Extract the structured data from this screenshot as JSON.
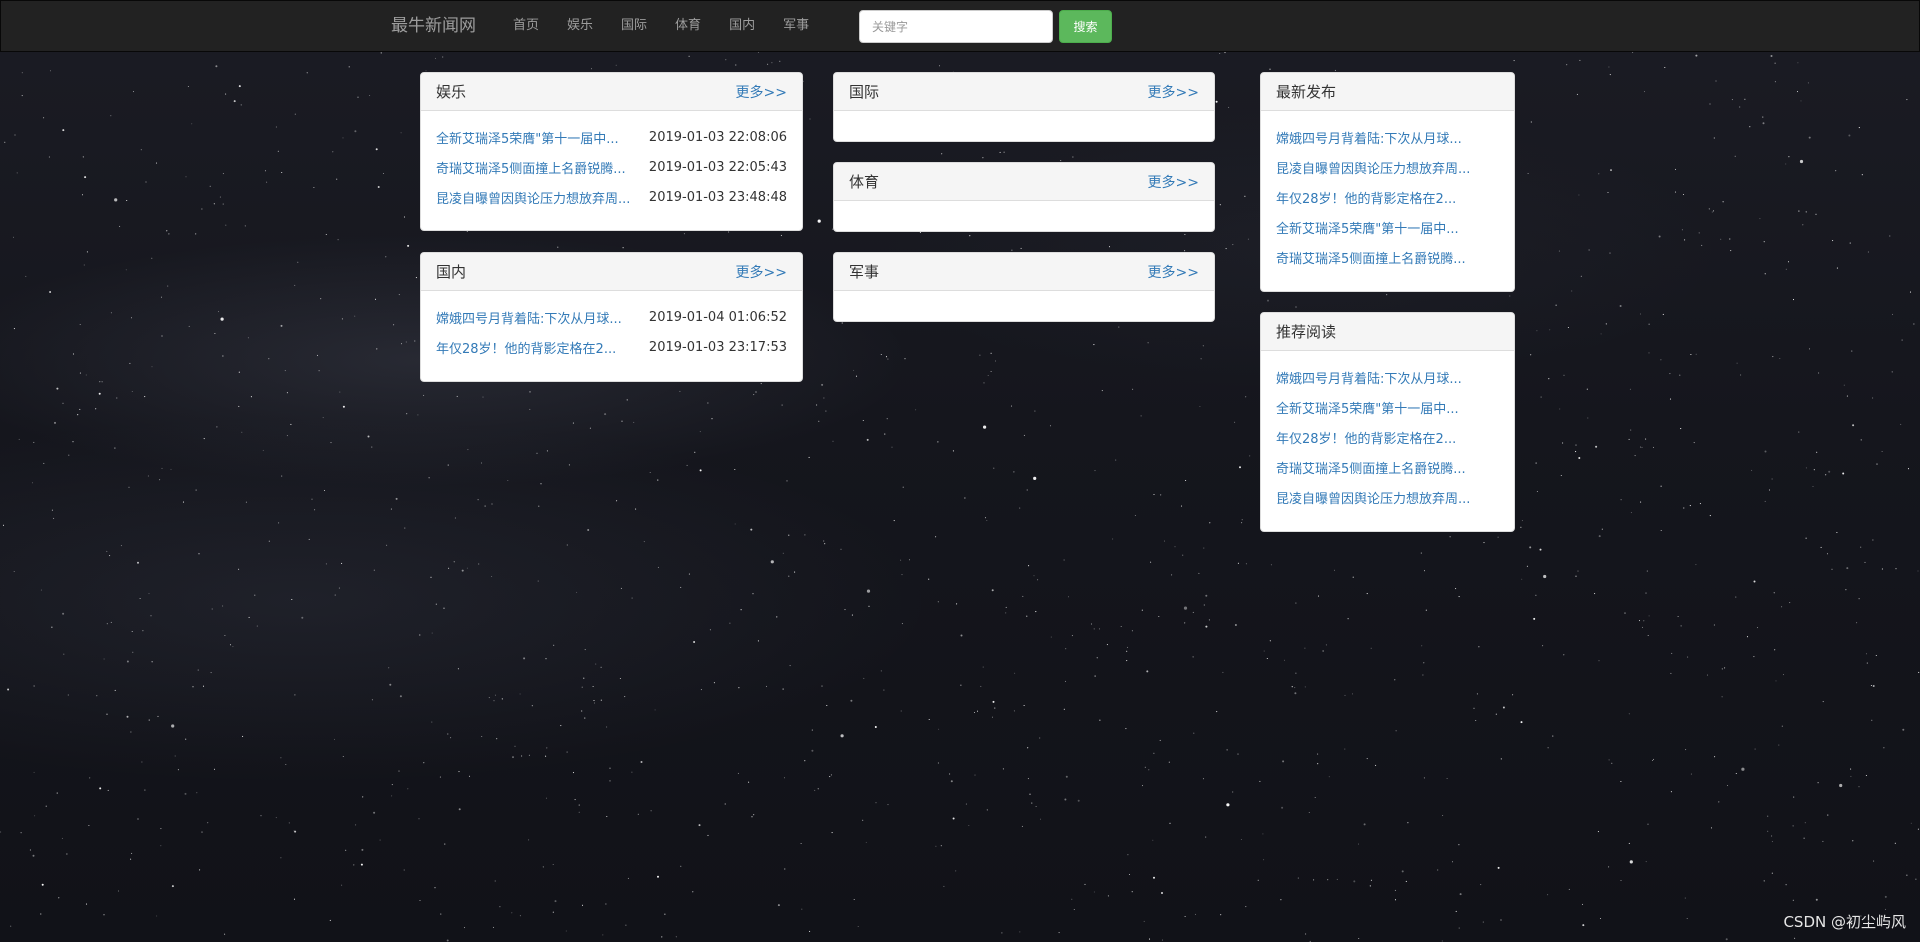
{
  "navbar": {
    "brand": "最牛新闻网",
    "links": [
      "首页",
      "娱乐",
      "国际",
      "体育",
      "国内",
      "军事"
    ],
    "search_placeholder": "关键字",
    "search_button": "搜索"
  },
  "panels": {
    "entertainment": {
      "title": "娱乐",
      "more": "更多>>",
      "items": [
        {
          "title": "全新艾瑞泽5荣膺\"第十一届中...",
          "time": "2019-01-03 22:08:06"
        },
        {
          "title": "奇瑞艾瑞泽5侧面撞上名爵锐腾...",
          "time": "2019-01-03 22:05:43"
        },
        {
          "title": "昆凌自曝曾因舆论压力想放弃周...",
          "time": "2019-01-03 23:48:48"
        }
      ]
    },
    "international": {
      "title": "国际",
      "more": "更多>>"
    },
    "sports": {
      "title": "体育",
      "more": "更多>>"
    },
    "domestic": {
      "title": "国内",
      "more": "更多>>",
      "items": [
        {
          "title": "嫦娥四号月背着陆:下次从月球...",
          "time": "2019-01-04 01:06:52"
        },
        {
          "title": "年仅28岁！他的背影定格在2...",
          "time": "2019-01-03 23:17:53"
        }
      ]
    },
    "military": {
      "title": "军事",
      "more": "更多>>"
    },
    "latest": {
      "title": "最新发布",
      "items": [
        "嫦娥四号月背着陆:下次从月球...",
        "昆凌自曝曾因舆论压力想放弃周...",
        "年仅28岁！他的背影定格在2...",
        "全新艾瑞泽5荣膺\"第十一届中...",
        "奇瑞艾瑞泽5侧面撞上名爵锐腾..."
      ]
    },
    "recommended": {
      "title": "推荐阅读",
      "items": [
        "嫦娥四号月背着陆:下次从月球...",
        "全新艾瑞泽5荣膺\"第十一届中...",
        "年仅28岁！他的背影定格在2...",
        "奇瑞艾瑞泽5侧面撞上名爵锐腾...",
        "昆凌自曝曾因舆论压力想放弃周..."
      ]
    }
  },
  "watermark": "CSDN @初尘屿风",
  "colors": {
    "navbar_bg": "#222222",
    "link_blue": "#337ab7",
    "search_button_green": "#5cb85c",
    "panel_heading_bg": "#f5f5f5"
  }
}
